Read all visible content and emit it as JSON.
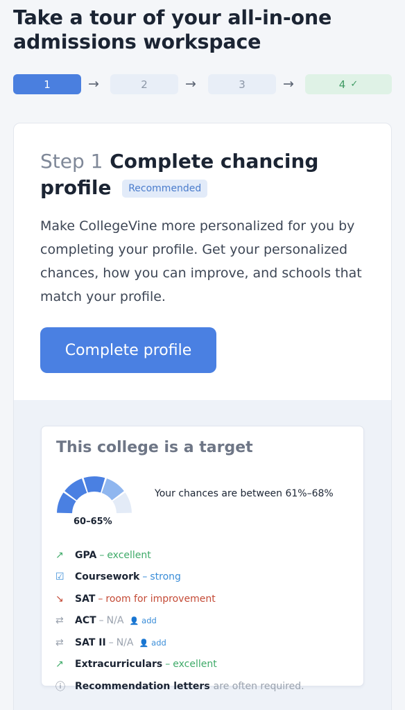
{
  "header": {
    "title": "Take a tour of your all-in-one admissions workspace"
  },
  "stepper": {
    "steps": [
      {
        "label": "1",
        "state": "active"
      },
      {
        "label": "2",
        "state": "pending"
      },
      {
        "label": "3",
        "state": "pending"
      },
      {
        "label": "4",
        "state": "done"
      }
    ],
    "arrow": "→",
    "done_check": "✓"
  },
  "step_card": {
    "step_prefix": "Step 1",
    "title": "Complete chancing profile",
    "badge": "Recommended",
    "description": "Make CollegeVine more personalized for you by completing your profile. Get your personalized chances, how you can improve, and schools that match your profile.",
    "cta_label": "Complete profile"
  },
  "preview": {
    "title": "This college is a target",
    "chances_text": "Your chances are between 61%–68%",
    "gauge_label": "60–65%",
    "gauge_level_segments": 3,
    "gauge_total_segments": 5,
    "factors": [
      {
        "icon": "trend-up-icon",
        "name": "GPA",
        "dash": "–",
        "rating": "excellent",
        "color": "green"
      },
      {
        "icon": "checkbox-icon",
        "name": "Coursework",
        "dash": "–",
        "rating": "strong",
        "color": "blue"
      },
      {
        "icon": "trend-down-icon",
        "name": "SAT",
        "dash": "–",
        "rating": "room for improvement",
        "color": "red"
      },
      {
        "icon": "swap-icon",
        "name": "ACT",
        "dash": "–",
        "rating": "N/A",
        "color": "gray",
        "add": "add"
      },
      {
        "icon": "swap-icon",
        "name": "SAT II",
        "dash": "–",
        "rating": "N/A",
        "color": "gray",
        "add": "add"
      },
      {
        "icon": "trend-up-icon",
        "name": "Extracurriculars",
        "dash": "–",
        "rating": "excellent",
        "color": "green"
      },
      {
        "icon": "info-icon",
        "name": "Recommendation letters",
        "tail": "are often required."
      }
    ]
  },
  "colors": {
    "primary": "#4a80e2",
    "step_active": "#4a7fdf",
    "step_done_bg": "#dff2e6",
    "excellent": "#3eaa68",
    "strong": "#3a8dd8",
    "improve": "#c44a36"
  }
}
